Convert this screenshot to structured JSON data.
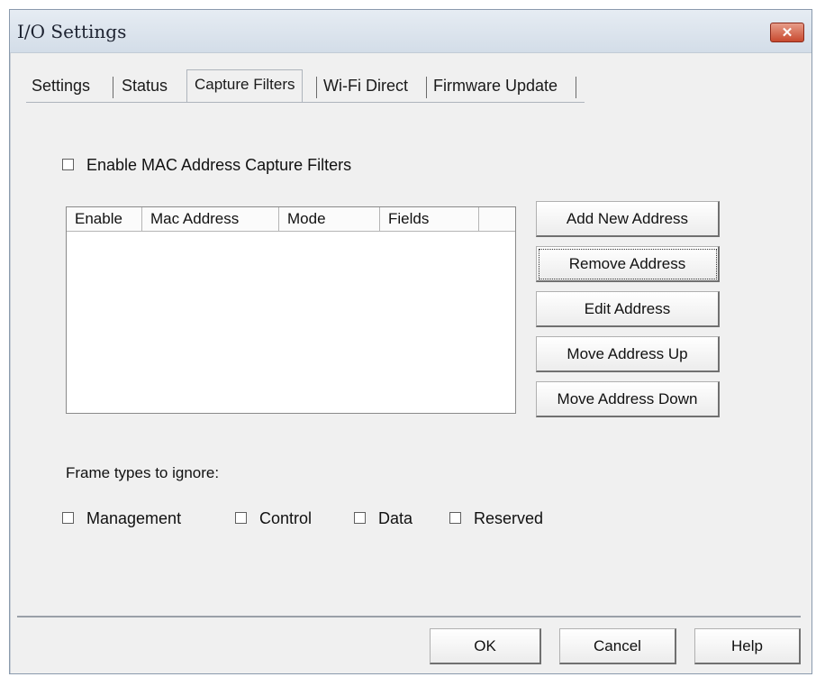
{
  "window": {
    "title": "I/O Settings",
    "close_label": "✕"
  },
  "tabs": [
    {
      "label": "Settings"
    },
    {
      "label": "Status"
    },
    {
      "label": "Capture Filters"
    },
    {
      "label": "Wi-Fi Direct"
    },
    {
      "label": "Firmware Update"
    }
  ],
  "enable_filters": {
    "label": "Enable MAC Address Capture Filters"
  },
  "table": {
    "columns": [
      "Enable",
      "Mac Address",
      "Mode",
      "Fields"
    ]
  },
  "actions": {
    "add": "Add New Address",
    "remove": "Remove Address",
    "edit": "Edit Address",
    "move_up": "Move Address Up",
    "move_down": "Move Address Down"
  },
  "frame_types": {
    "label": "Frame types to ignore:",
    "options": [
      "Management",
      "Control",
      "Data",
      "Reserved"
    ]
  },
  "footer": {
    "ok": "OK",
    "cancel": "Cancel",
    "help": "Help"
  }
}
